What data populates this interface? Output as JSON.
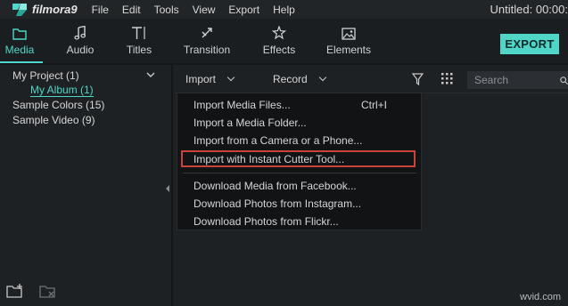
{
  "app": {
    "logo_text": "filmora9",
    "title": "Untitled: 00:00:"
  },
  "menu": [
    "File",
    "Edit",
    "Tools",
    "View",
    "Export",
    "Help"
  ],
  "tabs": [
    {
      "label": "Media",
      "icon": "folder-icon",
      "active": true
    },
    {
      "label": "Audio",
      "icon": "music-note-icon",
      "active": false
    },
    {
      "label": "Titles",
      "icon": "text-icon",
      "active": false
    },
    {
      "label": "Transition",
      "icon": "transition-icon",
      "active": false
    },
    {
      "label": "Effects",
      "icon": "effects-icon",
      "active": false
    },
    {
      "label": "Elements",
      "icon": "image-icon",
      "active": false
    }
  ],
  "export_label": "EXPORT",
  "tree": {
    "project": "My Project (1)",
    "album": "My Album (1)",
    "sample_colors": "Sample Colors (15)",
    "sample_video": "Sample Video (9)"
  },
  "toolbar": {
    "import_label": "Import",
    "record_label": "Record",
    "search_placeholder": "Search"
  },
  "dropdown": {
    "items": [
      {
        "label": "Import Media Files...",
        "shortcut": "Ctrl+I"
      },
      {
        "label": "Import a Media Folder...",
        "shortcut": ""
      },
      {
        "label": "Import from a Camera or a Phone...",
        "shortcut": ""
      },
      {
        "label": "Import with Instant Cutter Tool...",
        "shortcut": "",
        "highlighted": true
      },
      {
        "label": "Download Media from Facebook...",
        "shortcut": ""
      },
      {
        "label": "Download Photos from Instagram...",
        "shortcut": ""
      },
      {
        "label": "Download Photos from Flickr...",
        "shortcut": ""
      }
    ]
  },
  "watermark": "wvid.com",
  "colors": {
    "accent": "#4fd6c8",
    "highlight_border": "#c9433b",
    "background": "#1e2124"
  }
}
